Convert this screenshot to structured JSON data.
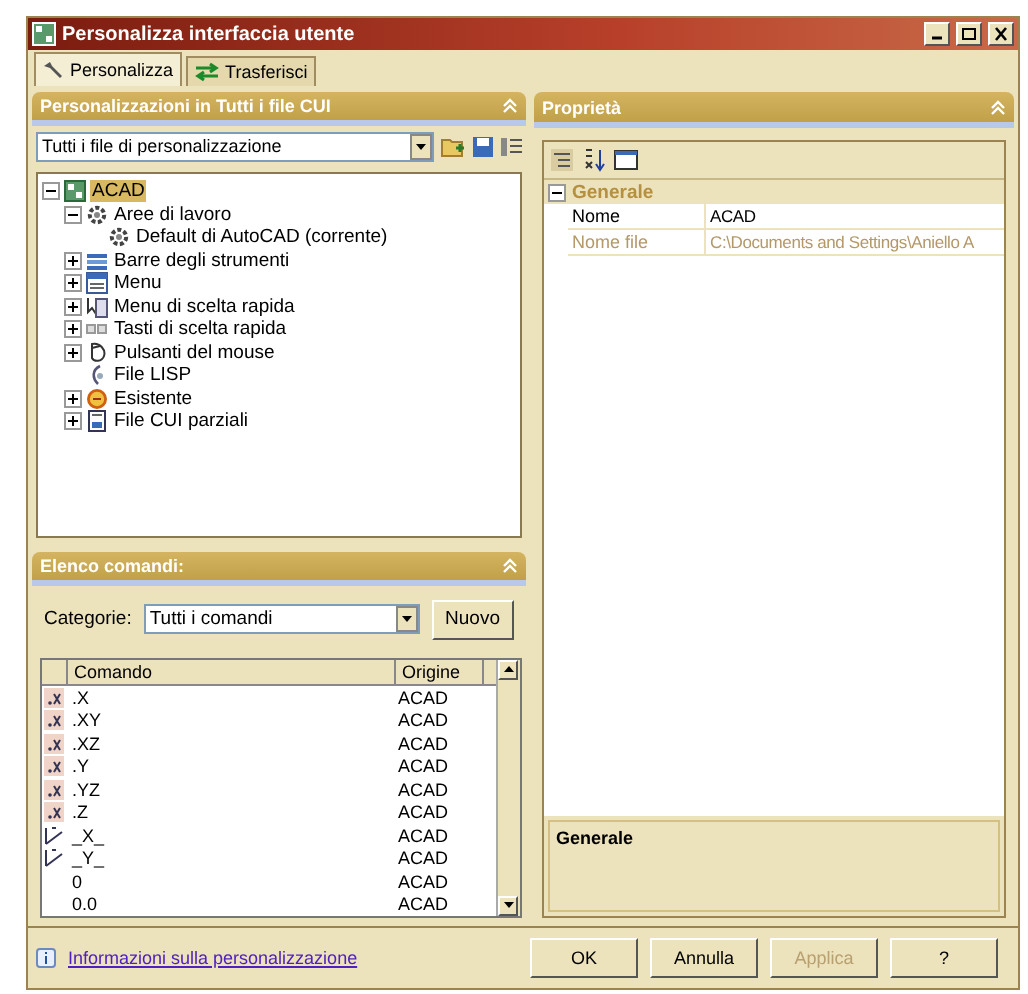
{
  "window": {
    "title": "Personalizza interfaccia utente"
  },
  "tabs": [
    {
      "label": "Personalizza",
      "selected": true,
      "kind": "wrench"
    },
    {
      "label": "Trasferisci",
      "selected": false,
      "kind": "arrows"
    }
  ],
  "customizations": {
    "title": "Personalizzazioni in Tutti i file CUI",
    "filter": "Tutti i file di personalizzazione",
    "tree": [
      {
        "label": "ACAD",
        "kind": "cui",
        "expanded": true,
        "selected": true,
        "children": [
          {
            "label": "Aree di lavoro",
            "kind": "gear",
            "expanded": true,
            "selected": false,
            "children": [
              {
                "label": "Default di AutoCAD (corrente)",
                "kind": "gear",
                "selected": false
              }
            ]
          },
          {
            "label": "Barre degli strumenti",
            "kind": "toolbar",
            "expanded": false,
            "selected": false
          },
          {
            "label": "Menu",
            "kind": "menu",
            "expanded": false,
            "selected": false
          },
          {
            "label": "Menu di scelta rapida",
            "kind": "context",
            "expanded": false,
            "selected": false
          },
          {
            "label": "Tasti di scelta rapida",
            "kind": "keys",
            "expanded": false,
            "selected": false
          },
          {
            "label": "Pulsanti del mouse",
            "kind": "mouse",
            "expanded": false,
            "selected": false
          },
          {
            "label": "File LISP",
            "kind": "lisp",
            "selected": false
          },
          {
            "label": "Esistente",
            "kind": "legacy",
            "expanded": false,
            "selected": false
          },
          {
            "label": "File CUI parziali",
            "kind": "partial",
            "expanded": false,
            "selected": false
          }
        ]
      }
    ]
  },
  "commands": {
    "title": "Elenco comandi:",
    "category_label": "Categorie:",
    "category": "Tutti i comandi",
    "new_button": "Nuovo",
    "columns": [
      "Comando",
      "Origine"
    ],
    "rows": [
      {
        "command": ".X",
        "origin": "ACAD",
        "kind": "icon"
      },
      {
        "command": ".XY",
        "origin": "ACAD",
        "kind": "icon"
      },
      {
        "command": ".XZ",
        "origin": "ACAD",
        "kind": "icon"
      },
      {
        "command": ".Y",
        "origin": "ACAD",
        "kind": "icon"
      },
      {
        "command": ".YZ",
        "origin": "ACAD",
        "kind": "icon"
      },
      {
        "command": ".Z",
        "origin": "ACAD",
        "kind": "icon"
      },
      {
        "command": "_X_",
        "origin": "ACAD",
        "kind": "line"
      },
      {
        "command": "_Y_",
        "origin": "ACAD",
        "kind": "line"
      },
      {
        "command": "0",
        "origin": "ACAD",
        "kind": "none"
      },
      {
        "command": "0.0",
        "origin": "ACAD",
        "kind": "none"
      }
    ]
  },
  "properties": {
    "title": "Proprietà",
    "category": "Generale",
    "expanded": true,
    "rows": [
      {
        "name": "Nome",
        "value": "ACAD",
        "disabled": false
      },
      {
        "name": "Nome file",
        "value": "C:\\Documents and Settings\\Aniello A",
        "disabled": true
      }
    ],
    "description_title": "Generale"
  },
  "info_link": "Informazioni sulla personalizzazione",
  "buttons": [
    {
      "label": "OK",
      "disabled": false
    },
    {
      "label": "Annulla",
      "disabled": false
    },
    {
      "label": "Applica",
      "disabled": true
    },
    {
      "label": "?",
      "disabled": false
    }
  ]
}
